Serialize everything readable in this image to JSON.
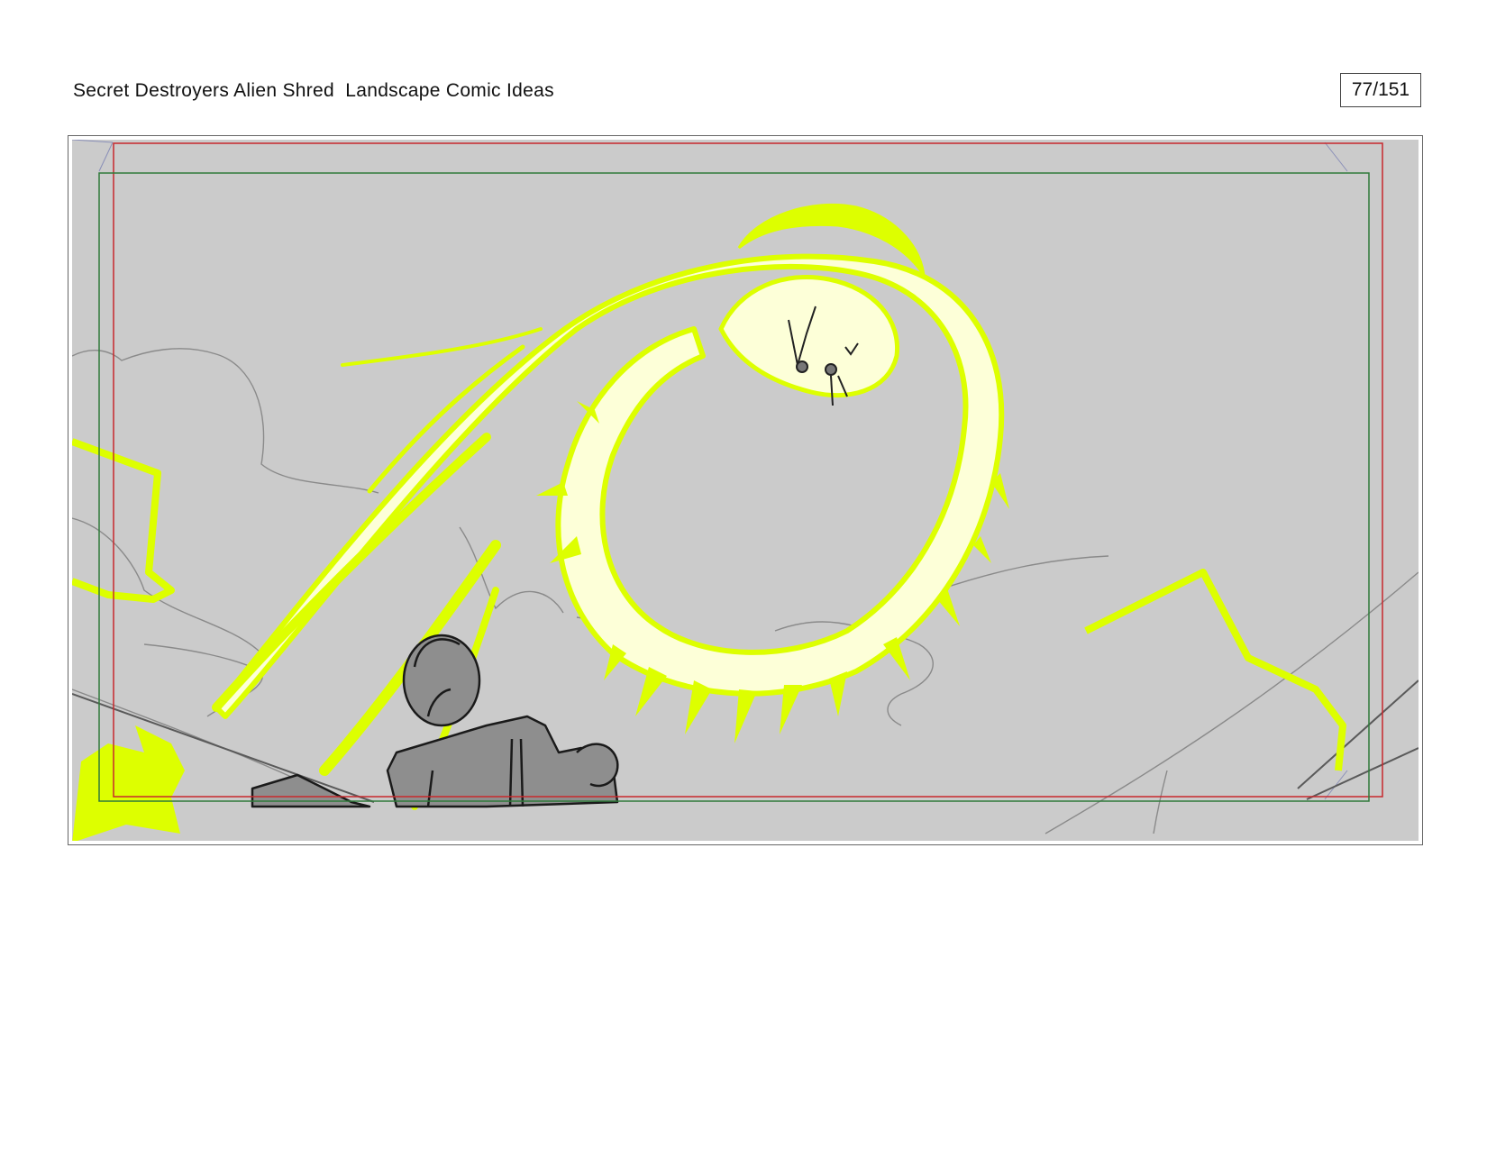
{
  "header": {
    "title": "Secret Destroyers Alien Shred  Landscape Comic Ideas",
    "page_counter": "77/151"
  },
  "panel": {
    "background_color": "#cbcbcb",
    "effect_color": "#ddff00",
    "glow_color": "#fdffd8",
    "figure_color": "#8e8e8e",
    "safe_frame_color": "#c8282c",
    "action_frame_color": "#2f7a3a",
    "icons": [
      "energy-blast-sketch",
      "human-figure-sketch",
      "cloud-sketch"
    ]
  }
}
